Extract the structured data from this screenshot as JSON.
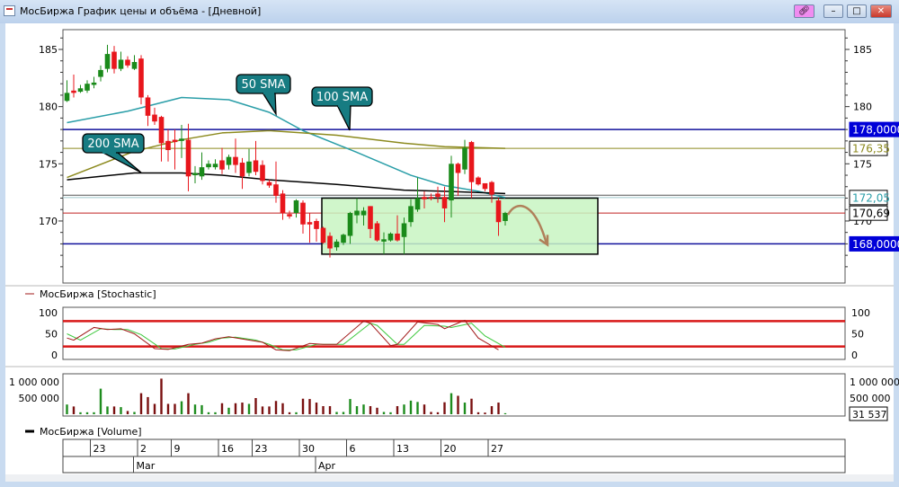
{
  "window": {
    "title": "МосБиржа График цены и объёма - [Дневной]",
    "buttons": {
      "link": "link-icon",
      "minimize": "minimize-icon",
      "maximize": "maximize-icon",
      "close": "close-icon"
    },
    "link_button_color": "#f08cf0",
    "close_button_color": "#d9463a"
  },
  "colors": {
    "up_candle": "#1a8a1a",
    "down_candle": "#e8161c",
    "sma50": "#2a9ea8",
    "sma100": "#8c8a1e",
    "sma200": "#000000",
    "level_line": "#10109c",
    "last_price_line": "#c02020",
    "zone_fill": "#c8f5c2",
    "callout_fill": "#177c82",
    "stoch_k": "#a01818",
    "stoch_d": "#3cc83c",
    "stoch_levels": "#d81818",
    "volume_up": "#1e8c1e",
    "volume_down": "#7a1010",
    "arrow": "#b0805a"
  },
  "chart_data": [
    {
      "type": "candlestick",
      "panel": "price",
      "ylim": [
        165.5,
        186.7
      ],
      "yticks": [
        185,
        180,
        175,
        170
      ],
      "ytick_labels": [
        "185",
        "180",
        "175",
        "170"
      ],
      "xlabel_note": "x = trading session number",
      "ohlc": [
        [
          180.5,
          181.2,
          182.3,
          180.4
        ],
        [
          181.4,
          181.2,
          182.8,
          180.8
        ],
        [
          181.3,
          181.6,
          181.9,
          181.2
        ],
        [
          181.4,
          182.0,
          182.3,
          181.2
        ],
        [
          181.9,
          182.1,
          182.6,
          181.6
        ],
        [
          182.6,
          183.2,
          183.6,
          182.2
        ],
        [
          183.3,
          184.6,
          185.4,
          183.0
        ],
        [
          184.8,
          183.3,
          185.3,
          182.9
        ],
        [
          183.3,
          184.1,
          184.8,
          183.1
        ],
        [
          184.1,
          183.6,
          184.4,
          183.4
        ],
        [
          183.3,
          183.9,
          184.5,
          183.2
        ],
        [
          184.2,
          180.8,
          184.5,
          180.2
        ],
        [
          180.8,
          179.2,
          181.0,
          178.3
        ],
        [
          179.3,
          178.7,
          179.9,
          178.4
        ],
        [
          179.1,
          176.8,
          179.2,
          175.2
        ],
        [
          177.0,
          176.2,
          178.0,
          175.2
        ],
        [
          177.1,
          176.9,
          178.0,
          174.5
        ],
        [
          177.0,
          177.2,
          178.4,
          175.5
        ],
        [
          177.1,
          173.9,
          178.5,
          172.6
        ],
        [
          174.0,
          174.2,
          174.8,
          173.3
        ],
        [
          173.9,
          174.7,
          176.0,
          173.6
        ],
        [
          174.7,
          175.0,
          175.3,
          174.5
        ],
        [
          174.7,
          175.0,
          175.4,
          174.5
        ],
        [
          175.3,
          174.5,
          176.4,
          174.1
        ],
        [
          174.9,
          175.6,
          175.8,
          174.5
        ],
        [
          175.6,
          174.9,
          177.2,
          174.2
        ],
        [
          175.1,
          173.9,
          175.5,
          172.8
        ],
        [
          174.2,
          175.2,
          176.3,
          173.9
        ],
        [
          175.3,
          174.3,
          177.0,
          174.0
        ],
        [
          174.9,
          173.5,
          175.3,
          173.2
        ],
        [
          173.4,
          173.1,
          173.6,
          172.9
        ],
        [
          173.2,
          172.2,
          175.2,
          171.6
        ],
        [
          172.4,
          170.7,
          172.7,
          170.1
        ],
        [
          170.6,
          170.4,
          170.9,
          170.2
        ],
        [
          170.7,
          171.8,
          171.9,
          170.3
        ],
        [
          171.6,
          169.7,
          171.8,
          168.9
        ],
        [
          169.9,
          169.7,
          170.7,
          168.1
        ],
        [
          170.0,
          169.3,
          170.2,
          168.2
        ],
        [
          169.4,
          168.1,
          169.5,
          168.0
        ],
        [
          168.7,
          167.6,
          169.0,
          166.8
        ],
        [
          167.7,
          168.2,
          168.4,
          167.4
        ],
        [
          168.1,
          168.8,
          168.9,
          167.9
        ],
        [
          168.7,
          170.7,
          170.8,
          168.0
        ],
        [
          170.5,
          170.9,
          172.0,
          169.8
        ],
        [
          170.5,
          170.9,
          171.2,
          169.6
        ],
        [
          171.3,
          169.3,
          171.3,
          168.5
        ],
        [
          169.8,
          168.3,
          170.0,
          168.2
        ],
        [
          168.2,
          168.4,
          169.0,
          167.1
        ],
        [
          168.3,
          168.9,
          169.0,
          168.2
        ],
        [
          168.9,
          168.3,
          170.5,
          168.2
        ],
        [
          168.6,
          169.8,
          170.3,
          167.1
        ],
        [
          169.9,
          171.3,
          171.9,
          169.5
        ],
        [
          171.0,
          172.0,
          173.8,
          170.8
        ],
        [
          172.1,
          171.9,
          172.6,
          171.1
        ],
        [
          172.1,
          172.0,
          172.4,
          171.8
        ],
        [
          172.4,
          172.1,
          173.0,
          171.6
        ],
        [
          172.1,
          171.1,
          173.0,
          169.9
        ],
        [
          171.8,
          175.0,
          175.7,
          170.3
        ],
        [
          175.0,
          174.2,
          175.1,
          172.2
        ],
        [
          174.5,
          176.4,
          177.1,
          174.1
        ],
        [
          176.9,
          173.4,
          177.0,
          172.0
        ],
        [
          173.8,
          173.2,
          173.9,
          173.1
        ],
        [
          173.3,
          172.8,
          173.3,
          172.6
        ],
        [
          173.4,
          172.3,
          173.5,
          171.6
        ],
        [
          171.8,
          169.9,
          172.0,
          168.7
        ],
        [
          170.0,
          170.7,
          170.8,
          169.6
        ]
      ],
      "sma": [
        {
          "name": "50 SMA",
          "points": [
            [
              1,
              178.6
            ],
            [
              10,
              179.6
            ],
            [
              18,
              180.8
            ],
            [
              25,
              180.6
            ],
            [
              31,
              179.5
            ],
            [
              36,
              177.9
            ],
            [
              44,
              176.0
            ],
            [
              52,
              174.0
            ],
            [
              57,
              173.1
            ],
            [
              62,
              172.6
            ],
            [
              66,
              172.05
            ]
          ]
        },
        {
          "name": "100 SMA",
          "points": [
            [
              1,
              173.8
            ],
            [
              11,
              176.1
            ],
            [
              18,
              177.1
            ],
            [
              24,
              177.7
            ],
            [
              31,
              177.9
            ],
            [
              41,
              177.5
            ],
            [
              51,
              176.8
            ],
            [
              57,
              176.5
            ],
            [
              66,
              176.35
            ]
          ]
        },
        {
          "name": "200 SMA",
          "points": [
            [
              1,
              173.6
            ],
            [
              11,
              174.2
            ],
            [
              18,
              174.2
            ],
            [
              24,
              174.0
            ],
            [
              31,
              173.6
            ],
            [
              41,
              173.2
            ],
            [
              51,
              172.7
            ],
            [
              57,
              172.6
            ],
            [
              66,
              172.4
            ]
          ]
        }
      ],
      "levels": [
        {
          "label": "178,00000",
          "value": 178.0,
          "style": "blue"
        },
        {
          "label": "176,35",
          "value": 176.35,
          "style": "sma100"
        },
        {
          "label": "172,05",
          "value": 172.05,
          "style": "sma50"
        },
        {
          "label": "170,69",
          "value": 170.69,
          "style": "last"
        },
        {
          "label": "168,00000",
          "value": 168.0,
          "style": "blue"
        }
      ],
      "zone": {
        "from_session": 40,
        "to_session": 80,
        "low": 167.1,
        "high": 172.0
      },
      "forecast_arrow": {
        "from": [
          66,
          170.7
        ],
        "to": [
          72,
          168.0
        ]
      }
    },
    {
      "type": "line",
      "panel": "stochastic",
      "legend": "МосБиржа [Stochastic]",
      "ylim": [
        0,
        100
      ],
      "yticks": [
        100,
        50,
        0
      ],
      "ytick_labels": [
        "100",
        "50",
        "0"
      ],
      "levels": [
        80,
        20
      ],
      "series": [
        {
          "id": "k",
          "points": [
            [
              1,
              40
            ],
            [
              2,
              35
            ],
            [
              5,
              65
            ],
            [
              7,
              60
            ],
            [
              9,
              62
            ],
            [
              11,
              50
            ],
            [
              14,
              15
            ],
            [
              16,
              13
            ],
            [
              19,
              25
            ],
            [
              21,
              28
            ],
            [
              23,
              38
            ],
            [
              25,
              43
            ],
            [
              28,
              35
            ],
            [
              30,
              30
            ],
            [
              32,
              12
            ],
            [
              34,
              10
            ],
            [
              37,
              27
            ],
            [
              39,
              25
            ],
            [
              41,
              25
            ],
            [
              45,
              80
            ],
            [
              46,
              75
            ],
            [
              49,
              22
            ],
            [
              50,
              25
            ],
            [
              53,
              78
            ],
            [
              56,
              72
            ],
            [
              57,
              62
            ],
            [
              60,
              82
            ],
            [
              62,
              40
            ],
            [
              65,
              12
            ]
          ]
        },
        {
          "id": "d",
          "points": [
            [
              1,
              50
            ],
            [
              3,
              35
            ],
            [
              6,
              62
            ],
            [
              8,
              60
            ],
            [
              10,
              60
            ],
            [
              12,
              48
            ],
            [
              15,
              15
            ],
            [
              17,
              14
            ],
            [
              20,
              25
            ],
            [
              22,
              30
            ],
            [
              24,
              40
            ],
            [
              26,
              42
            ],
            [
              29,
              35
            ],
            [
              31,
              25
            ],
            [
              33,
              12
            ],
            [
              35,
              12
            ],
            [
              38,
              25
            ],
            [
              40,
              25
            ],
            [
              42,
              25
            ],
            [
              46,
              75
            ],
            [
              47,
              70
            ],
            [
              50,
              25
            ],
            [
              51,
              25
            ],
            [
              54,
              70
            ],
            [
              57,
              68
            ],
            [
              58,
              65
            ],
            [
              61,
              75
            ],
            [
              63,
              45
            ],
            [
              66,
              18
            ]
          ]
        }
      ]
    },
    {
      "type": "bar",
      "panel": "volume",
      "legend": "МосБиржа [Volume]",
      "yticks": [
        1000000,
        500000
      ],
      "ytick_labels": [
        "1 000 000",
        "500 000"
      ],
      "last_label": "31 537",
      "values": [
        300000,
        240000,
        60000,
        60000,
        60000,
        790000,
        240000,
        240000,
        220000,
        100000,
        70000,
        650000,
        530000,
        320000,
        1100000,
        320000,
        320000,
        400000,
        650000,
        300000,
        280000,
        60000,
        60000,
        340000,
        200000,
        340000,
        360000,
        320000,
        500000,
        240000,
        240000,
        410000,
        340000,
        60000,
        60000,
        480000,
        470000,
        360000,
        250000,
        250000,
        70000,
        70000,
        470000,
        250000,
        300000,
        250000,
        200000,
        70000,
        60000,
        250000,
        300000,
        420000,
        380000,
        300000,
        70000,
        60000,
        370000,
        650000,
        570000,
        360000,
        480000,
        60000,
        50000,
        250000,
        360000,
        31537
      ],
      "directions": "gr ggg grgrg rrrrrrgrgggrgrrgrrrrrgrrrrrgggggrrggrgggrgrgrgrrrrg"
    }
  ],
  "date_axis": {
    "days": [
      {
        "label": "23",
        "session": 5
      },
      {
        "label": "2",
        "session": 12
      },
      {
        "label": "9",
        "session": 17
      },
      {
        "label": "16",
        "session": 24
      },
      {
        "label": "23",
        "session": 29
      },
      {
        "label": "30",
        "session": 36
      },
      {
        "label": "6",
        "session": 43
      },
      {
        "label": "13",
        "session": 50
      },
      {
        "label": "20",
        "session": 57
      },
      {
        "label": "27",
        "session": 64
      }
    ],
    "months": [
      {
        "label": "Mar",
        "session": 11
      },
      {
        "label": "Apr",
        "session": 38
      }
    ]
  }
}
